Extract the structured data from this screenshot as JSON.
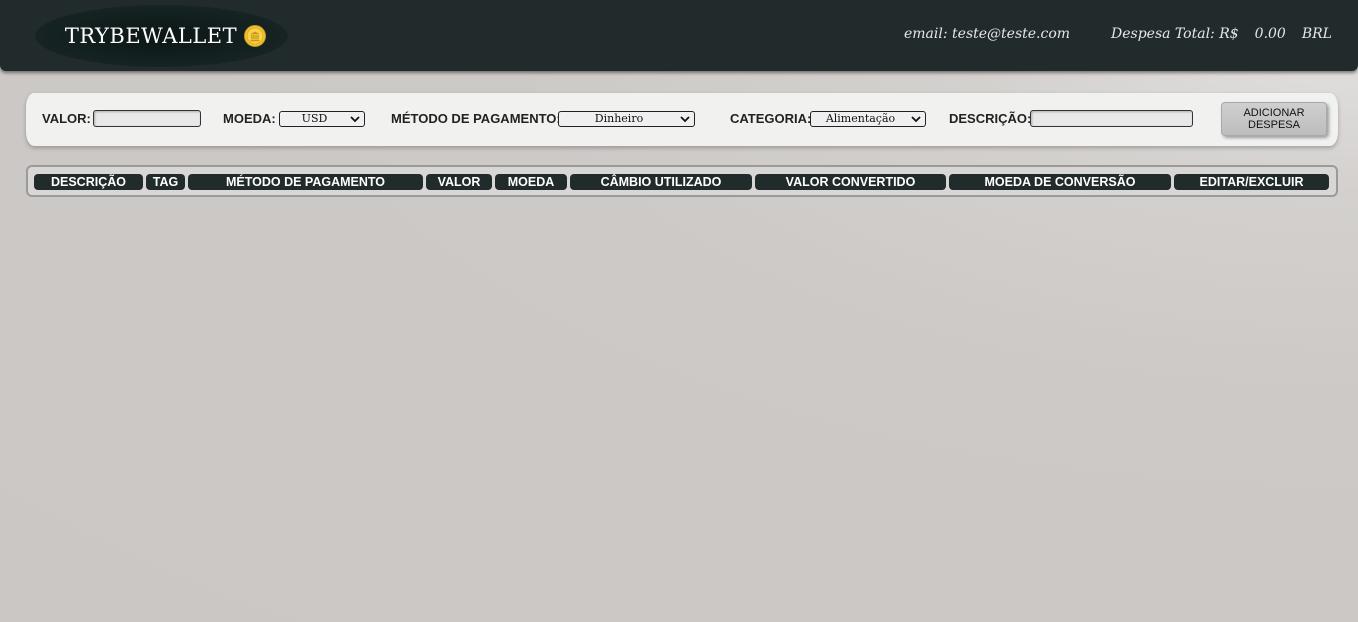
{
  "header": {
    "logo_text": "TRYBEWALLET",
    "logo_icon": "coin-icon",
    "email_text": "email: teste@teste.com",
    "total_label": "Despesa Total: R$",
    "total_value": "0.00",
    "total_currency": "BRL"
  },
  "form": {
    "value_label": "VALOR:",
    "value_input": "",
    "currency_label": "MOEDA:",
    "currency_selected": "USD",
    "method_label": "MÉTODO DE PAGAMENTO:",
    "method_selected": "Dinheiro",
    "category_label": "CATEGORIA:",
    "category_selected": "Alimentação",
    "description_label": "DESCRIÇÃO:",
    "description_input": "",
    "add_button": "ADICIONAR DESPESA"
  },
  "table": {
    "headers": [
      "DESCRIÇÃO",
      "TAG",
      "MÉTODO DE PAGAMENTO",
      "VALOR",
      "MOEDA",
      "CÂMBIO UTILIZADO",
      "VALOR CONVERTIDO",
      "MOEDA DE CONVERSÃO",
      "EDITAR/EXCLUIR"
    ],
    "rows": []
  },
  "colors": {
    "header_bg": "#212b2b",
    "page_bg": "#cdc9c7",
    "form_bg": "#f1f1f0",
    "coin": "#f2c230"
  }
}
